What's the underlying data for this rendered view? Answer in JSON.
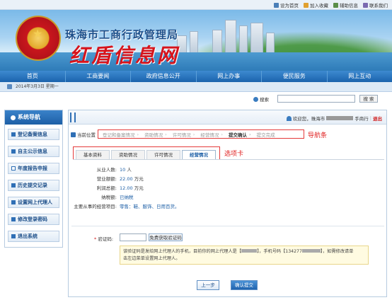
{
  "toplinks": [
    {
      "label": "设为首页",
      "icon": "home-icon"
    },
    {
      "label": "加入收藏",
      "icon": "favorite-icon"
    },
    {
      "label": "辅助信息",
      "icon": "info-icon"
    },
    {
      "label": "联系我们",
      "icon": "contact-icon"
    }
  ],
  "banner": {
    "bureau_name": "珠海市工商行政管理局",
    "slogan": "红盾信息网"
  },
  "nav": [
    "首页",
    "工商要闻",
    "政府信息公开",
    "网上办事",
    "便民服务",
    "网上互动"
  ],
  "datebar": {
    "date": "2014年3月3日 星期一"
  },
  "search": {
    "label": "搜索",
    "button": "搜 索",
    "value": ""
  },
  "sidebar": {
    "title": "系统导航",
    "items": [
      {
        "label": "登记备案信息",
        "active": false
      },
      {
        "label": "自主公示信息",
        "active": false
      },
      {
        "label": "年度报告申报",
        "active": true
      },
      {
        "label": "历史提交记录",
        "active": false
      },
      {
        "label": "设置网上代理人",
        "active": false
      },
      {
        "label": "修改登录密码",
        "active": false
      },
      {
        "label": "退出系统",
        "active": false
      }
    ]
  },
  "header": {
    "welcome": "欢迎您，珠海市",
    "company_suffix": "手商行",
    "logout": "退出"
  },
  "breadcrumb": {
    "label": "当前位置"
  },
  "steps": [
    "登记和备案情况",
    "资助情况",
    "许可情况",
    "经营情况",
    "提交确认",
    "提交完成"
  ],
  "current_step": 4,
  "annotations": {
    "nav": "导航条",
    "tabs": "选项卡"
  },
  "tabs": [
    "基本资料",
    "资助情况",
    "许可情况",
    "经营情况"
  ],
  "current_tab": 3,
  "form": {
    "employees": {
      "label": "从业人数:",
      "value": "10",
      "unit": "人"
    },
    "revenue": {
      "label": "营业额额:",
      "value": "22.00",
      "unit": "万元"
    },
    "profit": {
      "label": "利润总额:",
      "value": "12.00",
      "unit": "万元"
    },
    "tax": {
      "label": "纳税额:",
      "value": "已纳税"
    },
    "business": {
      "label": "主要从事的经营项目:",
      "value": "零售：鞋、服饰、日用百货。"
    }
  },
  "verify": {
    "required_mark": "*",
    "label": "验证码:",
    "button": "免费获取验证码",
    "notice_1": "该验证码是发给网上代理人的手机，目前你的网上代理人是【",
    "notice_2": "】，手机号码【134277",
    "notice_3": "】，如需修改请单",
    "notice_4": "击左边菜单设置网上代理人。"
  },
  "buttons": {
    "prev": "上一步",
    "submit": "确认提交"
  },
  "colors": {
    "nav_blue": "#1b63ad",
    "accent_red": "#e43a3a",
    "notice_bg": "#fffbe1"
  }
}
